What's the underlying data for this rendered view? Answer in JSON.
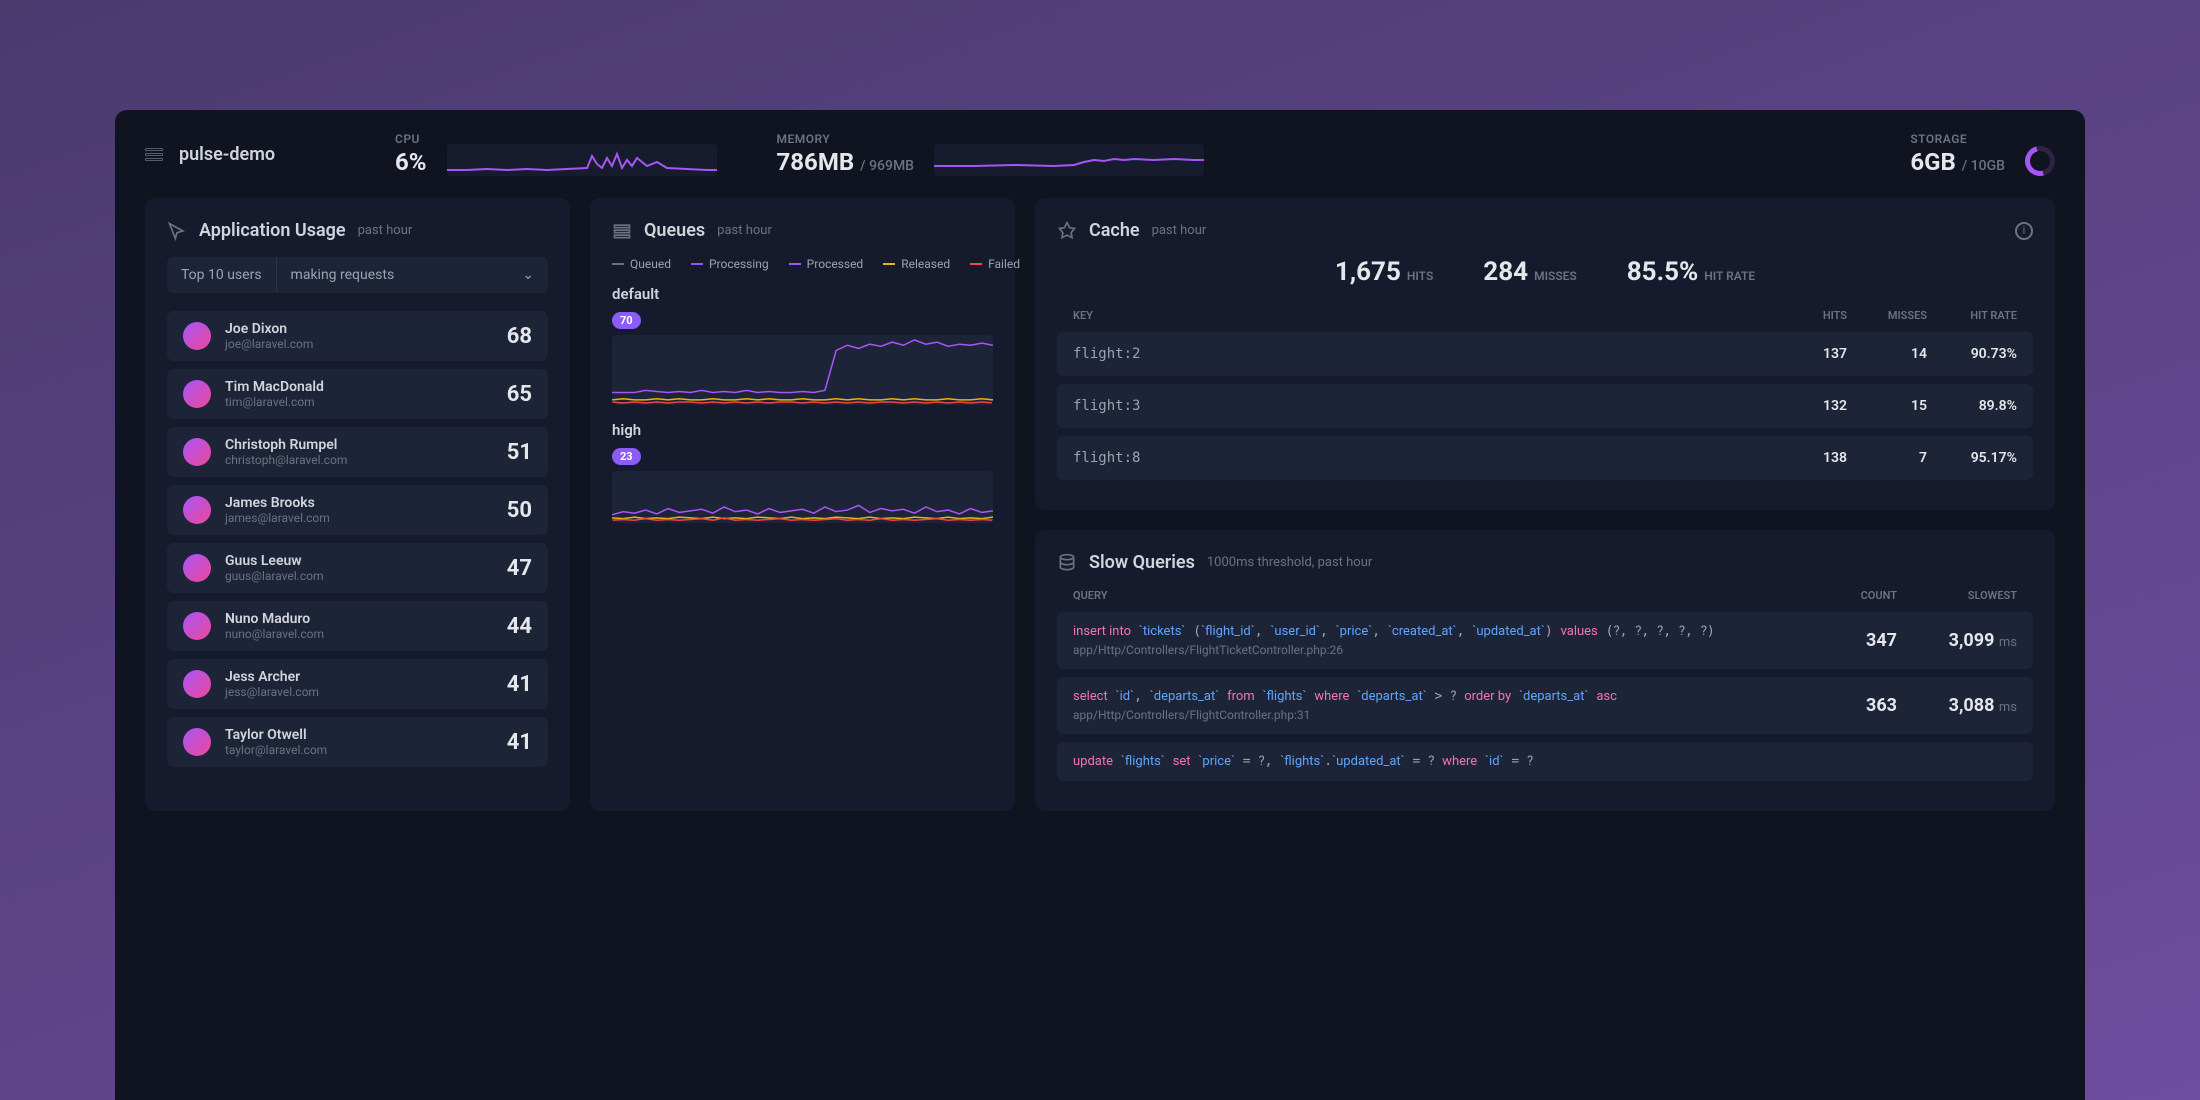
{
  "host": {
    "name": "pulse-demo"
  },
  "top": {
    "cpu": {
      "label": "CPU",
      "value": "6%"
    },
    "memory": {
      "label": "MEMORY",
      "value": "786MB",
      "total": "/ 969MB"
    },
    "storage": {
      "label": "STORAGE",
      "value": "6GB",
      "total": "/ 10GB"
    }
  },
  "usage": {
    "title": "Application Usage",
    "subtitle": "past hour",
    "select_left": "Top 10 users",
    "select_right": "making requests",
    "users": [
      {
        "name": "Joe Dixon",
        "email": "joe@laravel.com",
        "count": "68"
      },
      {
        "name": "Tim MacDonald",
        "email": "tim@laravel.com",
        "count": "65"
      },
      {
        "name": "Christoph Rumpel",
        "email": "christoph@laravel.com",
        "count": "51"
      },
      {
        "name": "James Brooks",
        "email": "james@laravel.com",
        "count": "50"
      },
      {
        "name": "Guus Leeuw",
        "email": "guus@laravel.com",
        "count": "47"
      },
      {
        "name": "Nuno Maduro",
        "email": "nuno@laravel.com",
        "count": "44"
      },
      {
        "name": "Jess Archer",
        "email": "jess@laravel.com",
        "count": "41"
      },
      {
        "name": "Taylor Otwell",
        "email": "taylor@laravel.com",
        "count": "41"
      }
    ]
  },
  "queues": {
    "title": "Queues",
    "subtitle": "past hour",
    "legend": [
      "Queued",
      "Processing",
      "Processed",
      "Released",
      "Failed"
    ],
    "colors": [
      "#6b7280",
      "#8b5cf6",
      "#a855f7",
      "#eab308",
      "#ef4444"
    ],
    "items": [
      {
        "name": "default",
        "badge": "70"
      },
      {
        "name": "high",
        "badge": "23"
      }
    ]
  },
  "cache": {
    "title": "Cache",
    "subtitle": "past hour",
    "stats": [
      {
        "val": "1,675",
        "label": "HITS"
      },
      {
        "val": "284",
        "label": "MISSES"
      },
      {
        "val": "85.5%",
        "label": "HIT RATE"
      }
    ],
    "headers": [
      "KEY",
      "HITS",
      "MISSES",
      "HIT RATE"
    ],
    "rows": [
      {
        "key": "flight:2",
        "hits": "137",
        "misses": "14",
        "rate": "90.73%"
      },
      {
        "key": "flight:3",
        "hits": "132",
        "misses": "15",
        "rate": "89.8%"
      },
      {
        "key": "flight:8",
        "hits": "138",
        "misses": "7",
        "rate": "95.17%"
      }
    ]
  },
  "slow": {
    "title": "Slow Queries",
    "subtitle": "1000ms threshold, past hour",
    "headers": [
      "QUERY",
      "COUNT",
      "SLOWEST"
    ],
    "rows": [
      {
        "sql_html": "<span class='kw'>insert into</span> <span class='bt'>`tickets`</span> (<span class='bt'>`flight_id`</span>, <span class='bt'>`user_id`</span>, <span class='bt'>`price`</span>, <span class='bt'>`created_at`</span>, <span class='bt'>`updated_at`</span>) <span class='kw'>values</span> (<span class='ph'>?</span>, <span class='ph'>?</span>, <span class='ph'>?</span>, <span class='ph'>?</span>, <span class='ph'>?</span>)",
        "loc": "app/Http/Controllers/FlightTicketController.php:26",
        "count": "347",
        "slowest": "3,099",
        "unit": "ms"
      },
      {
        "sql_html": "<span class='kw'>select</span> <span class='bt'>`id`</span>, <span class='bt'>`departs_at`</span> <span class='kw'>from</span> <span class='bt'>`flights`</span> <span class='kw'>where</span> <span class='bt'>`departs_at`</span> > <span class='ph'>?</span> <span class='kw'>order by</span> <span class='bt'>`departs_at`</span> <span class='kw'>asc</span>",
        "loc": "app/Http/Controllers/FlightController.php:31",
        "count": "363",
        "slowest": "3,088",
        "unit": "ms"
      },
      {
        "sql_html": "<span class='kw'>update</span> <span class='bt'>`flights`</span> <span class='kw'>set</span> <span class='bt'>`price`</span> = <span class='ph'>?</span>, <span class='bt'>`flights`</span>.<span class='bt'>`updated_at`</span> = <span class='ph'>?</span> <span class='kw'>where</span> <span class='bt'>`id`</span> = <span class='ph'>?</span>",
        "loc": "",
        "count": "",
        "slowest": "",
        "unit": ""
      }
    ]
  },
  "chart_data": {
    "sparklines": [
      {
        "name": "cpu",
        "type": "line",
        "ylim": [
          0,
          20
        ],
        "values": [
          3,
          3,
          3,
          3,
          4,
          3,
          3,
          3,
          4,
          3,
          3,
          3,
          3,
          4,
          3,
          3,
          3,
          6,
          12,
          8,
          6,
          10,
          7,
          14,
          6,
          9,
          5,
          7,
          11,
          6,
          8,
          5,
          4,
          4,
          4
        ]
      },
      {
        "name": "memory",
        "type": "line",
        "ylim": [
          700,
          850
        ],
        "values": [
          760,
          762,
          760,
          763,
          761,
          764,
          760,
          762,
          761,
          763,
          760,
          762,
          761,
          764,
          760,
          763,
          761,
          780,
          790,
          785,
          780,
          790,
          786,
          788,
          784,
          790,
          786,
          784,
          790,
          786,
          788,
          786,
          786,
          786,
          786
        ]
      }
    ],
    "queues": [
      {
        "name": "default",
        "type": "line",
        "x_unit": "time (past hour)",
        "series": [
          {
            "name": "Processed",
            "color": "#a855f7",
            "values": [
              10,
              10,
              10,
              12,
              11,
              10,
              11,
              10,
              12,
              10,
              11,
              10,
              12,
              10,
              11,
              10,
              10,
              11,
              10,
              12,
              50,
              55,
              52,
              56,
              54,
              58,
              55,
              60,
              56,
              58,
              54,
              56,
              55,
              57,
              55
            ]
          },
          {
            "name": "Released",
            "color": "#eab308",
            "values": [
              3,
              4,
              3,
              3,
              4,
              3,
              4,
              3,
              3,
              4,
              3,
              3,
              4,
              3,
              4,
              3,
              3,
              4,
              3,
              3,
              4,
              3,
              4,
              3,
              3,
              4,
              3,
              4,
              3,
              3,
              4,
              3,
              3,
              4,
              3
            ]
          },
          {
            "name": "Failed",
            "color": "#ef4444",
            "values": [
              1,
              0,
              1,
              0,
              1,
              0,
              1,
              1,
              0,
              1,
              0,
              1,
              0,
              1,
              0,
              1,
              1,
              0,
              1,
              0,
              1,
              0,
              1,
              0,
              1,
              1,
              0,
              1,
              0,
              1,
              0,
              1,
              0,
              1,
              0
            ]
          }
        ]
      },
      {
        "name": "high",
        "type": "line",
        "x_unit": "time (past hour)",
        "series": [
          {
            "name": "Processed",
            "color": "#a855f7",
            "values": [
              8,
              12,
              10,
              14,
              9,
              16,
              11,
              13,
              15,
              10,
              18,
              12,
              14,
              9,
              16,
              11,
              13,
              15,
              10,
              18,
              12,
              14,
              20,
              11,
              16,
              13,
              15,
              10,
              18,
              12,
              14,
              9,
              16,
              11,
              13
            ]
          },
          {
            "name": "Released",
            "color": "#eab308",
            "values": [
              4,
              3,
              5,
              3,
              4,
              3,
              5,
              4,
              3,
              5,
              3,
              4,
              3,
              5,
              4,
              3,
              5,
              3,
              4,
              3,
              5,
              4,
              3,
              5,
              3,
              4,
              3,
              5,
              4,
              3,
              5,
              3,
              4,
              3,
              5
            ]
          },
          {
            "name": "Failed",
            "color": "#ef4444",
            "values": [
              1,
              2,
              1,
              3,
              1,
              2,
              1,
              2,
              3,
              1,
              4,
              1,
              2,
              1,
              2,
              3,
              1,
              2,
              1,
              2,
              3,
              1,
              2,
              1,
              3,
              1,
              2,
              1,
              2,
              3,
              1,
              2,
              1,
              2,
              1
            ]
          }
        ]
      }
    ]
  }
}
